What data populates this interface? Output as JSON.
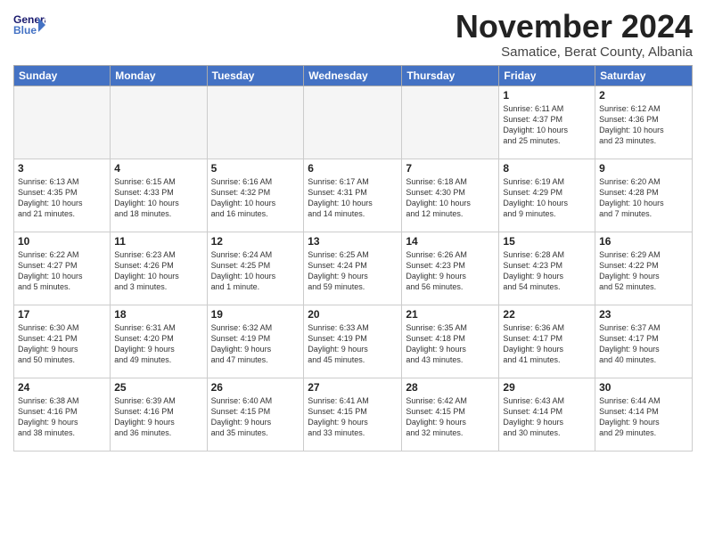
{
  "header": {
    "logo_line1": "General",
    "logo_line2": "Blue",
    "month": "November 2024",
    "location": "Samatice, Berat County, Albania"
  },
  "weekdays": [
    "Sunday",
    "Monday",
    "Tuesday",
    "Wednesday",
    "Thursday",
    "Friday",
    "Saturday"
  ],
  "weeks": [
    [
      {
        "day": "",
        "info": ""
      },
      {
        "day": "",
        "info": ""
      },
      {
        "day": "",
        "info": ""
      },
      {
        "day": "",
        "info": ""
      },
      {
        "day": "",
        "info": ""
      },
      {
        "day": "1",
        "info": "Sunrise: 6:11 AM\nSunset: 4:37 PM\nDaylight: 10 hours\nand 25 minutes."
      },
      {
        "day": "2",
        "info": "Sunrise: 6:12 AM\nSunset: 4:36 PM\nDaylight: 10 hours\nand 23 minutes."
      }
    ],
    [
      {
        "day": "3",
        "info": "Sunrise: 6:13 AM\nSunset: 4:35 PM\nDaylight: 10 hours\nand 21 minutes."
      },
      {
        "day": "4",
        "info": "Sunrise: 6:15 AM\nSunset: 4:33 PM\nDaylight: 10 hours\nand 18 minutes."
      },
      {
        "day": "5",
        "info": "Sunrise: 6:16 AM\nSunset: 4:32 PM\nDaylight: 10 hours\nand 16 minutes."
      },
      {
        "day": "6",
        "info": "Sunrise: 6:17 AM\nSunset: 4:31 PM\nDaylight: 10 hours\nand 14 minutes."
      },
      {
        "day": "7",
        "info": "Sunrise: 6:18 AM\nSunset: 4:30 PM\nDaylight: 10 hours\nand 12 minutes."
      },
      {
        "day": "8",
        "info": "Sunrise: 6:19 AM\nSunset: 4:29 PM\nDaylight: 10 hours\nand 9 minutes."
      },
      {
        "day": "9",
        "info": "Sunrise: 6:20 AM\nSunset: 4:28 PM\nDaylight: 10 hours\nand 7 minutes."
      }
    ],
    [
      {
        "day": "10",
        "info": "Sunrise: 6:22 AM\nSunset: 4:27 PM\nDaylight: 10 hours\nand 5 minutes."
      },
      {
        "day": "11",
        "info": "Sunrise: 6:23 AM\nSunset: 4:26 PM\nDaylight: 10 hours\nand 3 minutes."
      },
      {
        "day": "12",
        "info": "Sunrise: 6:24 AM\nSunset: 4:25 PM\nDaylight: 10 hours\nand 1 minute."
      },
      {
        "day": "13",
        "info": "Sunrise: 6:25 AM\nSunset: 4:24 PM\nDaylight: 9 hours\nand 59 minutes."
      },
      {
        "day": "14",
        "info": "Sunrise: 6:26 AM\nSunset: 4:23 PM\nDaylight: 9 hours\nand 56 minutes."
      },
      {
        "day": "15",
        "info": "Sunrise: 6:28 AM\nSunset: 4:23 PM\nDaylight: 9 hours\nand 54 minutes."
      },
      {
        "day": "16",
        "info": "Sunrise: 6:29 AM\nSunset: 4:22 PM\nDaylight: 9 hours\nand 52 minutes."
      }
    ],
    [
      {
        "day": "17",
        "info": "Sunrise: 6:30 AM\nSunset: 4:21 PM\nDaylight: 9 hours\nand 50 minutes."
      },
      {
        "day": "18",
        "info": "Sunrise: 6:31 AM\nSunset: 4:20 PM\nDaylight: 9 hours\nand 49 minutes."
      },
      {
        "day": "19",
        "info": "Sunrise: 6:32 AM\nSunset: 4:19 PM\nDaylight: 9 hours\nand 47 minutes."
      },
      {
        "day": "20",
        "info": "Sunrise: 6:33 AM\nSunset: 4:19 PM\nDaylight: 9 hours\nand 45 minutes."
      },
      {
        "day": "21",
        "info": "Sunrise: 6:35 AM\nSunset: 4:18 PM\nDaylight: 9 hours\nand 43 minutes."
      },
      {
        "day": "22",
        "info": "Sunrise: 6:36 AM\nSunset: 4:17 PM\nDaylight: 9 hours\nand 41 minutes."
      },
      {
        "day": "23",
        "info": "Sunrise: 6:37 AM\nSunset: 4:17 PM\nDaylight: 9 hours\nand 40 minutes."
      }
    ],
    [
      {
        "day": "24",
        "info": "Sunrise: 6:38 AM\nSunset: 4:16 PM\nDaylight: 9 hours\nand 38 minutes."
      },
      {
        "day": "25",
        "info": "Sunrise: 6:39 AM\nSunset: 4:16 PM\nDaylight: 9 hours\nand 36 minutes."
      },
      {
        "day": "26",
        "info": "Sunrise: 6:40 AM\nSunset: 4:15 PM\nDaylight: 9 hours\nand 35 minutes."
      },
      {
        "day": "27",
        "info": "Sunrise: 6:41 AM\nSunset: 4:15 PM\nDaylight: 9 hours\nand 33 minutes."
      },
      {
        "day": "28",
        "info": "Sunrise: 6:42 AM\nSunset: 4:15 PM\nDaylight: 9 hours\nand 32 minutes."
      },
      {
        "day": "29",
        "info": "Sunrise: 6:43 AM\nSunset: 4:14 PM\nDaylight: 9 hours\nand 30 minutes."
      },
      {
        "day": "30",
        "info": "Sunrise: 6:44 AM\nSunset: 4:14 PM\nDaylight: 9 hours\nand 29 minutes."
      }
    ]
  ]
}
